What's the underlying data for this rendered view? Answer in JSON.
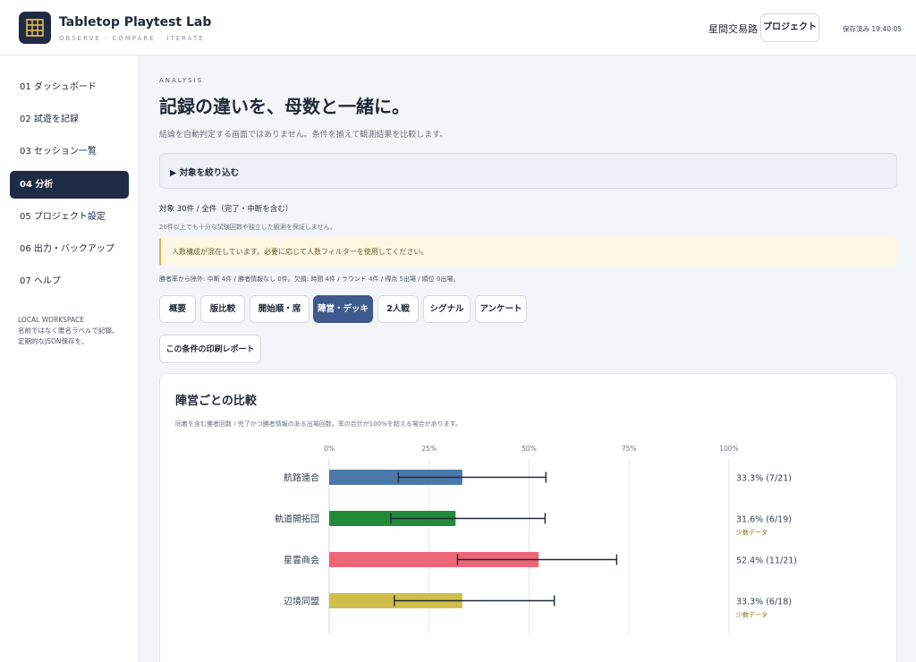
{
  "app": {
    "title": "Tabletop Playtest Lab",
    "tagline": "OBSERVE · COMPARE · ITERATE",
    "logo_icon": "grid-icon"
  },
  "header": {
    "project_name": "星間交易路",
    "project_button": "プロジェクト",
    "save_status": "保存済み 19:40:05"
  },
  "sidebar": {
    "items": [
      {
        "label": "01 ダッシュボード",
        "active": false
      },
      {
        "label": "02 試遊を記録",
        "active": false
      },
      {
        "label": "03 セッション一覧",
        "active": false
      },
      {
        "label": "04 分析",
        "active": true
      },
      {
        "label": "05 プロジェクト設定",
        "active": false
      },
      {
        "label": "06 出力・バックアップ",
        "active": false
      },
      {
        "label": "07 ヘルプ",
        "active": false
      }
    ],
    "note": [
      "LOCAL WORKSPACE",
      "名前ではなく匿名ラベルで記録。",
      "定期的なJSON保存を。"
    ]
  },
  "main": {
    "eyebrow": "ANALYSIS",
    "title": "記録の違いを、母数と一緒に。",
    "subtitle": "結論を自動判定する画面ではありません。条件を揃えて観測結果を比較します。",
    "filter_toggle": "▶ 対象を絞り込む",
    "target_count": "対象 30件 / 全件（完了・中断を含む）",
    "caveat": "20件以上でも十分な試験回数や独立した観測を保証しません。",
    "warning": "人数構成が混在しています。必要に応じて人数フィルターを使用してください。",
    "exclusions": "勝者率から除外: 中断 4件 / 勝者情報なし 0件。欠損: 時間 4件 / ラウンド 4件 / 得点 5出場 / 順位 0出場。",
    "tabs": [
      {
        "label": "概要",
        "active": false
      },
      {
        "label": "版比較",
        "active": false
      },
      {
        "label": "開始順・席",
        "active": false
      },
      {
        "label": "陣営・デッキ",
        "active": true
      },
      {
        "label": "2人戦",
        "active": false
      },
      {
        "label": "シグナル",
        "active": false
      },
      {
        "label": "アンケート",
        "active": false
      }
    ],
    "print_button": "この条件の印刷レポート"
  },
  "card": {
    "title": "陣営ごとの比較",
    "note": "同着を含む勝者回数 / 完了かつ勝者情報のある出場回数。率の合計が100%を超える場合があります。"
  },
  "chart_data": {
    "type": "bar",
    "orientation": "horizontal",
    "categories": [
      "航路連合",
      "軌道開拓団",
      "星雲商会",
      "辺境同盟"
    ],
    "values": [
      33.3,
      31.6,
      52.4,
      33.3
    ],
    "error_low": [
      17.3,
      15.4,
      32.1,
      16.3
    ],
    "error_high": [
      54.2,
      54.0,
      71.9,
      56.3
    ],
    "value_labels": [
      "33.3% (7/21)",
      "31.6% (6/19)",
      "52.4% (11/21)",
      "33.3% (6/18)"
    ],
    "flags": [
      "",
      "少数データ",
      "",
      "少数データ"
    ],
    "colors": [
      "#4a78a8",
      "#238a3a",
      "#ec6677",
      "#cfbf4a"
    ],
    "xlim": [
      0,
      100
    ],
    "ticks": [
      "0%",
      "25%",
      "50%",
      "75%",
      "100%"
    ],
    "tick_values": [
      0,
      25,
      50,
      75,
      100
    ],
    "grid": true
  }
}
